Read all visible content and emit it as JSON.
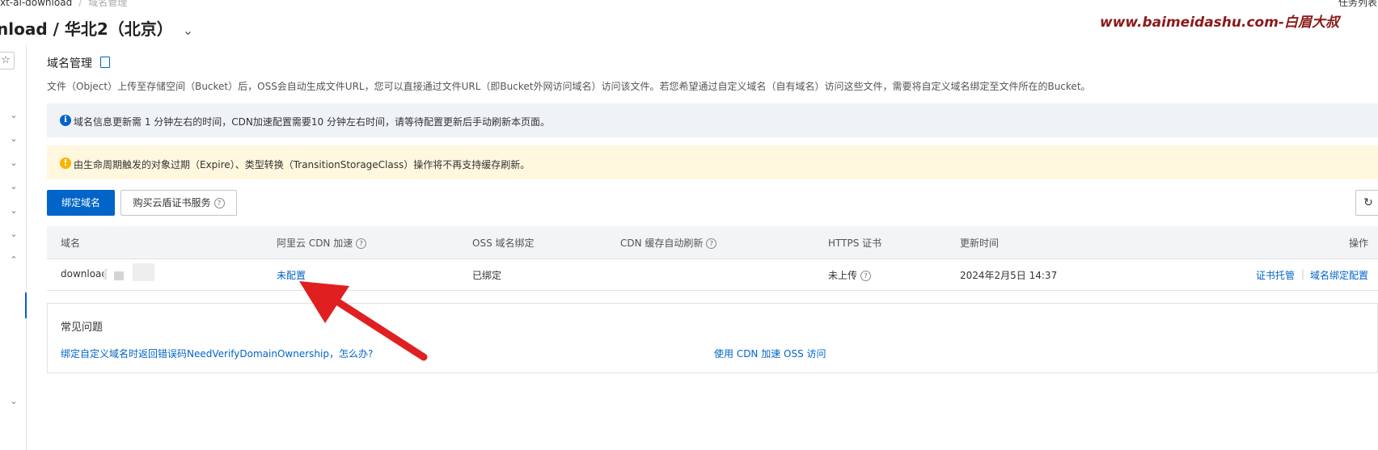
{
  "header": {
    "breadcrumb": [
      "xt-ai-download",
      "域名管理"
    ],
    "title": "nload / 华北2（北京）",
    "watermark": "www.baimeidashu.com-白眉大叔",
    "task_list": "任务列表"
  },
  "section": {
    "title": "域名管理",
    "description": "文件（Object）上传至存储空间（Bucket）后，OSS会自动生成文件URL，您可以直接通过文件URL（即Bucket外网访问域名）访问该文件。若您希望通过自定义域名（自有域名）访问这些文件，需要将自定义域名绑定至文件所在的Bucket。"
  },
  "notices": {
    "info": "域名信息更新需 1 分钟左右的时间，CDN加速配置需要10 分钟左右时间，请等待配置更新后手动刷新本页面。",
    "warning": "由生命周期触发的对象过期（Expire）、类型转换（TransitionStorageClass）操作将不再支持缓存刷新。"
  },
  "toolbar": {
    "bind_domain": "绑定域名",
    "buy_cert": "购买云盾证书服务"
  },
  "table": {
    "columns": [
      "域名",
      "阿里云 CDN 加速",
      "OSS 域名绑定",
      "CDN 缓存自动刷新",
      "HTTPS 证书",
      "更新时间",
      "操作"
    ],
    "rows": [
      {
        "domain": "download",
        "cdn": "未配置",
        "oss_binding": "已绑定",
        "https": "未上传",
        "updated": "2024年2月5日 14:37",
        "actions": [
          "证书托管",
          "域名绑定配置"
        ]
      }
    ]
  },
  "faq": {
    "title": "常见问题",
    "links": [
      "绑定自定义域名时返回错误码NeedVerifyDomainOwnership，怎么办?",
      "使用 CDN 加速 OSS 访问"
    ]
  },
  "colors": {
    "primary": "#0064c8",
    "watermark": "#8b1a1a",
    "info_bg": "#eff3f8",
    "warn_bg": "#fff7de",
    "arrow": "#e02020"
  }
}
